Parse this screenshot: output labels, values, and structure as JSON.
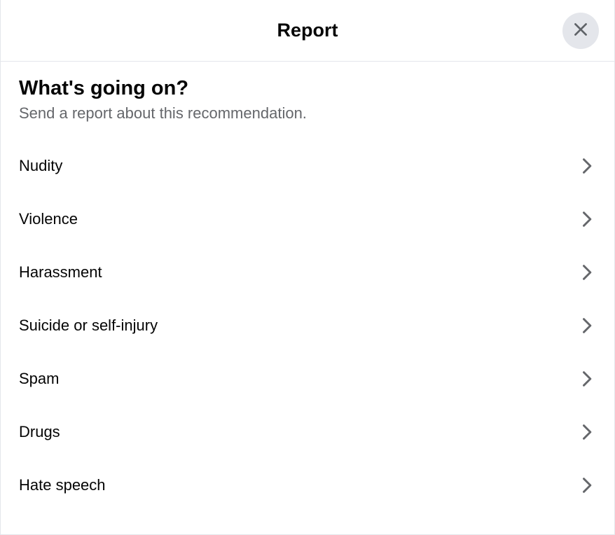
{
  "header": {
    "title": "Report"
  },
  "section": {
    "title": "What's going on?",
    "subtitle": "Send a report about this recommendation."
  },
  "options": [
    {
      "label": "Nudity"
    },
    {
      "label": "Violence"
    },
    {
      "label": "Harassment"
    },
    {
      "label": "Suicide or self-injury"
    },
    {
      "label": "Spam"
    },
    {
      "label": "Drugs"
    },
    {
      "label": "Hate speech"
    }
  ]
}
